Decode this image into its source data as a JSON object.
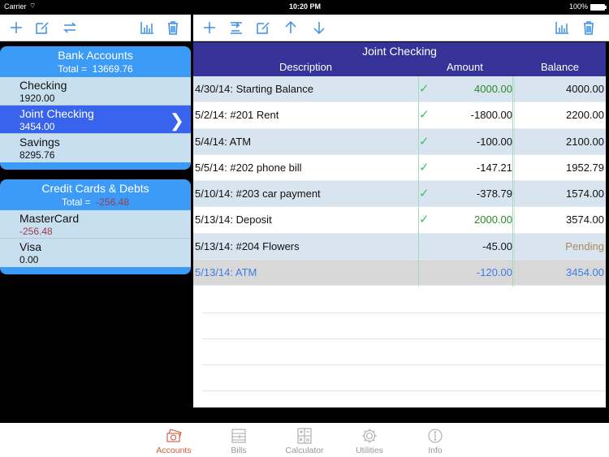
{
  "status_bar": {
    "carrier": "Carrier",
    "time": "10:20 PM",
    "battery": "100%"
  },
  "left_toolbar": {
    "icons": [
      "plus-icon",
      "edit-icon",
      "transfer-icon",
      "chart-icon",
      "trash-icon"
    ]
  },
  "right_toolbar": {
    "icons": [
      "plus-icon",
      "indent-icon",
      "edit-icon",
      "arrow-up-icon",
      "arrow-down-icon",
      "chart-icon",
      "trash-icon"
    ]
  },
  "groups": [
    {
      "title": "Bank Accounts",
      "total_label": "Total =",
      "total": "13669.76",
      "accounts": [
        {
          "name": "Checking",
          "balance": "1920.00"
        },
        {
          "name": "Joint Checking",
          "balance": "3454.00"
        },
        {
          "name": "Savings",
          "balance": "8295.76"
        }
      ]
    },
    {
      "title": "Credit Cards & Debts",
      "total_label": "Total =",
      "total": "-256.48",
      "accounts": [
        {
          "name": "MasterCard",
          "balance": "-256.48"
        },
        {
          "name": "Visa",
          "balance": "0.00"
        }
      ]
    }
  ],
  "register": {
    "title": "Joint Checking",
    "columns": {
      "description": "Description",
      "amount": "Amount",
      "balance": "Balance"
    },
    "rows": [
      {
        "description": "4/30/14: Starting Balance",
        "cleared": true,
        "amount": "4000.00",
        "balance": "4000.00"
      },
      {
        "description": "5/2/14: #201 Rent",
        "cleared": true,
        "amount": "-1800.00",
        "balance": "2200.00"
      },
      {
        "description": "5/4/14: ATM",
        "cleared": true,
        "amount": "-100.00",
        "balance": "2100.00"
      },
      {
        "description": "5/5/14: #202 phone bill",
        "cleared": true,
        "amount": "-147.21",
        "balance": "1952.79"
      },
      {
        "description": "5/10/14: #203 car payment",
        "cleared": true,
        "amount": "-378.79",
        "balance": "1574.00"
      },
      {
        "description": "5/13/14: Deposit",
        "cleared": true,
        "amount": "2000.00",
        "balance": "3574.00"
      },
      {
        "description": "5/13/14: #204 Flowers",
        "cleared": false,
        "amount": "-45.00",
        "balance": "Pending"
      },
      {
        "description": "5/13/14: ATM",
        "cleared": false,
        "amount": "-120.00",
        "balance": "3454.00"
      }
    ],
    "check_glyph": "✓"
  },
  "tabs": [
    {
      "label": "Accounts",
      "icon": "money-icon",
      "active": true
    },
    {
      "label": "Bills",
      "icon": "bills-icon"
    },
    {
      "label": "Calculator",
      "icon": "calculator-icon"
    },
    {
      "label": "Utilities",
      "icon": "gear-icon"
    },
    {
      "label": "Info",
      "icon": "info-icon"
    }
  ],
  "colors": {
    "accent": "#3a8ee6",
    "header": "#353397",
    "group": "#3d9bf8",
    "selected": "#3863ec",
    "positive": "#2a8a2a",
    "negative": "#a03a4a",
    "pending": "#b0875a",
    "active_tab": "#d0593f"
  }
}
